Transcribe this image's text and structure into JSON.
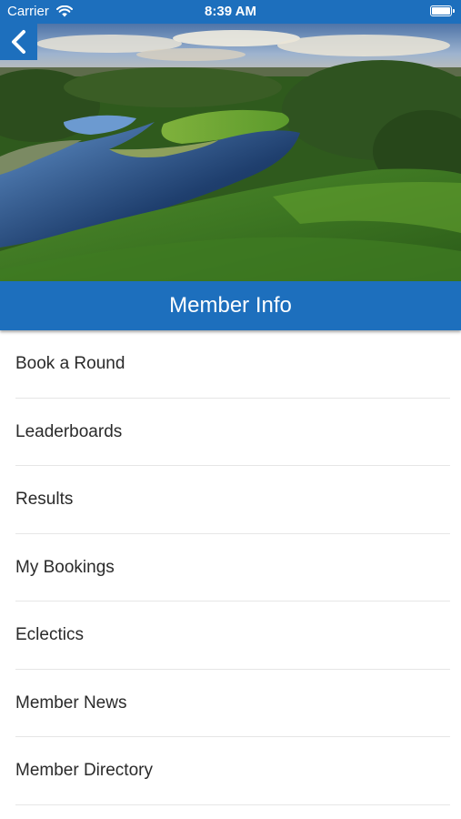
{
  "status_bar": {
    "carrier": "Carrier",
    "time": "8:39 AM",
    "wifi_icon": "wifi-icon",
    "battery_icon": "battery-icon"
  },
  "navigation": {
    "back_icon": "chevron-left-icon"
  },
  "hero_image": {
    "subject": "golf-course-aerial-photo"
  },
  "header": {
    "title": "Member Info"
  },
  "menu": {
    "items": [
      {
        "label": "Book a Round"
      },
      {
        "label": "Leaderboards"
      },
      {
        "label": "Results"
      },
      {
        "label": "My Bookings"
      },
      {
        "label": "Eclectics"
      },
      {
        "label": "Member News"
      },
      {
        "label": "Member Directory"
      }
    ]
  },
  "colors": {
    "brand_blue": "#1d6fbd",
    "text": "#2a2a2a",
    "divider": "#e6e6e6"
  }
}
